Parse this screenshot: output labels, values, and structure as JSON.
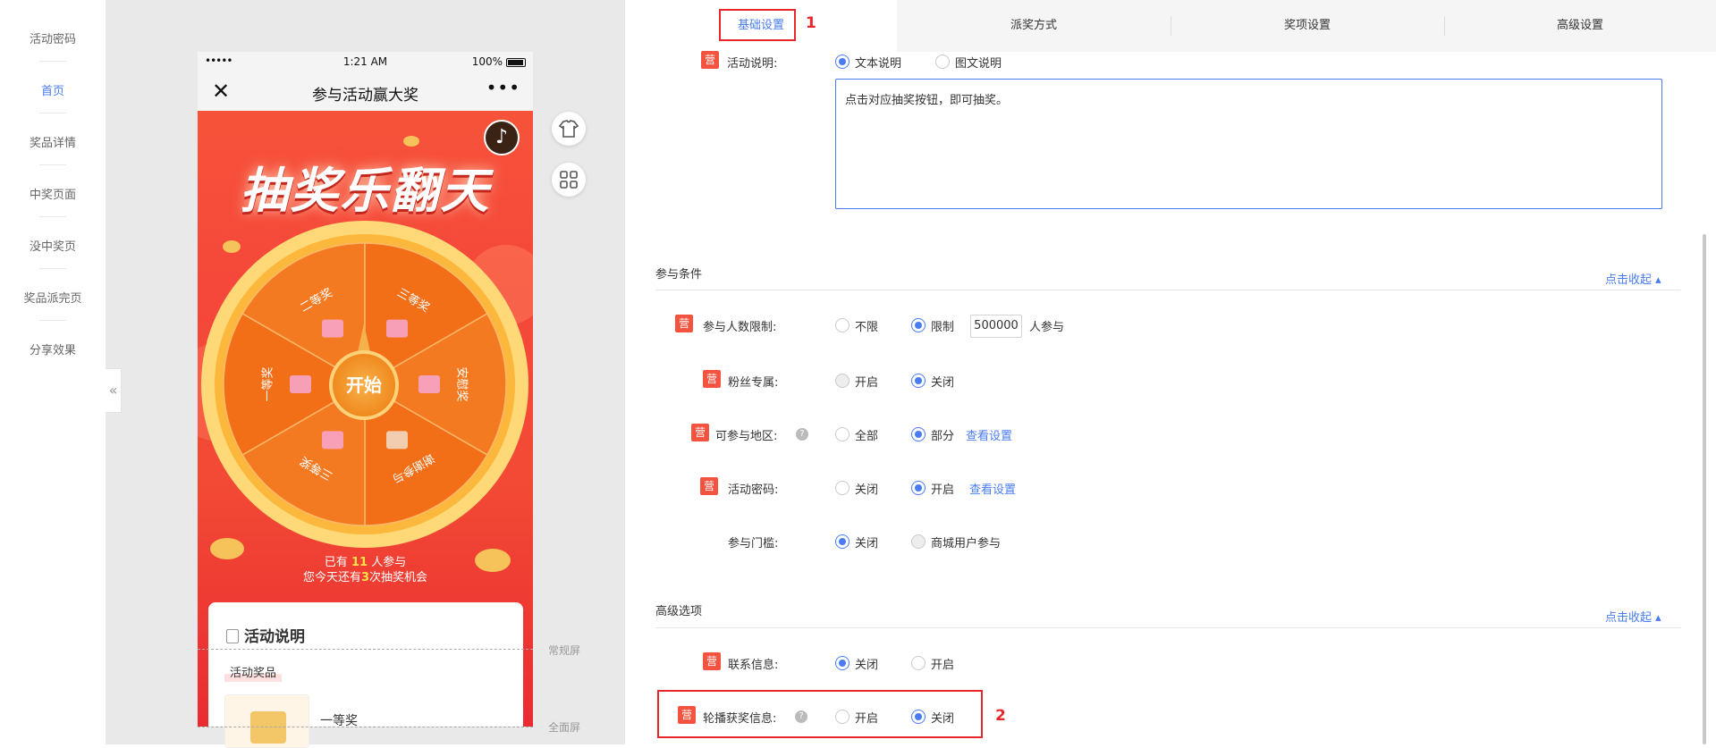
{
  "sidebar": {
    "items": [
      {
        "label": "活动密码"
      },
      {
        "label": "首页"
      },
      {
        "label": "奖品详情"
      },
      {
        "label": "中奖页面"
      },
      {
        "label": "没中奖页"
      },
      {
        "label": "奖品派完页"
      },
      {
        "label": "分享效果"
      }
    ],
    "active_index": 1,
    "collapse_glyph": "«"
  },
  "phone": {
    "status": {
      "dots": "•••••",
      "time": "1:21 AM",
      "battery_text": "100%"
    },
    "nav": {
      "title": "参与活动赢大奖",
      "close": "✕",
      "more": "•••"
    },
    "hero_title": "抽奖乐翻天",
    "music_icon": "♪",
    "wheel": {
      "prizes": [
        "二等奖",
        "三等奖",
        "安慰奖",
        "谢谢参与",
        "三等奖",
        "一等奖"
      ],
      "button": "开始"
    },
    "participants_pre": "已有",
    "participants_count": "11",
    "participants_post": "人参与",
    "chances_pre": "您今天还有",
    "chances_count": "3",
    "chances_post": "次抽奖机会",
    "card": {
      "title": "活动说明",
      "tag": "活动奖品",
      "prize_name": "一等奖"
    }
  },
  "screen_markers": {
    "normal": "常规屏",
    "full": "全面屏"
  },
  "tools": [
    {
      "icon": "shirt-icon"
    },
    {
      "icon": "grid-icon"
    }
  ],
  "tabs": [
    {
      "label": "基础设置",
      "active": true
    },
    {
      "label": "派奖方式"
    },
    {
      "label": "奖项设置"
    },
    {
      "label": "高级设置"
    }
  ],
  "annotations": {
    "one": "1",
    "two": "2"
  },
  "form": {
    "badge": "营",
    "activity_desc": {
      "label": "活动说明:",
      "opt_text": "文本说明",
      "opt_image": "图文说明",
      "value": "点击对应抽奖按钮，即可抽奖。"
    },
    "section_participation": {
      "title": "参与条件",
      "collapse": "点击收起"
    },
    "limit_people": {
      "label": "参与人数限制:",
      "opt_none": "不限",
      "opt_limit": "限制",
      "value": "500000",
      "suffix": "人参与"
    },
    "fans_only": {
      "label": "粉丝专属:",
      "opt_on": "开启",
      "opt_off": "关闭"
    },
    "region": {
      "label": "可参与地区:",
      "opt_all": "全部",
      "opt_part": "部分",
      "link": "查看设置"
    },
    "password": {
      "label": "活动密码:",
      "opt_off": "关闭",
      "opt_on": "开启",
      "link": "查看设置"
    },
    "threshold": {
      "label": "参与门槛:",
      "opt_off": "关闭",
      "opt_mall": "商城用户参与"
    },
    "section_advanced": {
      "title": "高级选项",
      "collapse": "点击收起"
    },
    "contact": {
      "label": "联系信息:",
      "opt_off": "关闭",
      "opt_on": "开启"
    },
    "carousel": {
      "label": "轮播获奖信息:",
      "opt_on": "开启",
      "opt_off": "关闭"
    }
  },
  "colors": {
    "accent": "#4a7cf1",
    "badge": "#f3533f",
    "annotation": "#e8262c"
  }
}
